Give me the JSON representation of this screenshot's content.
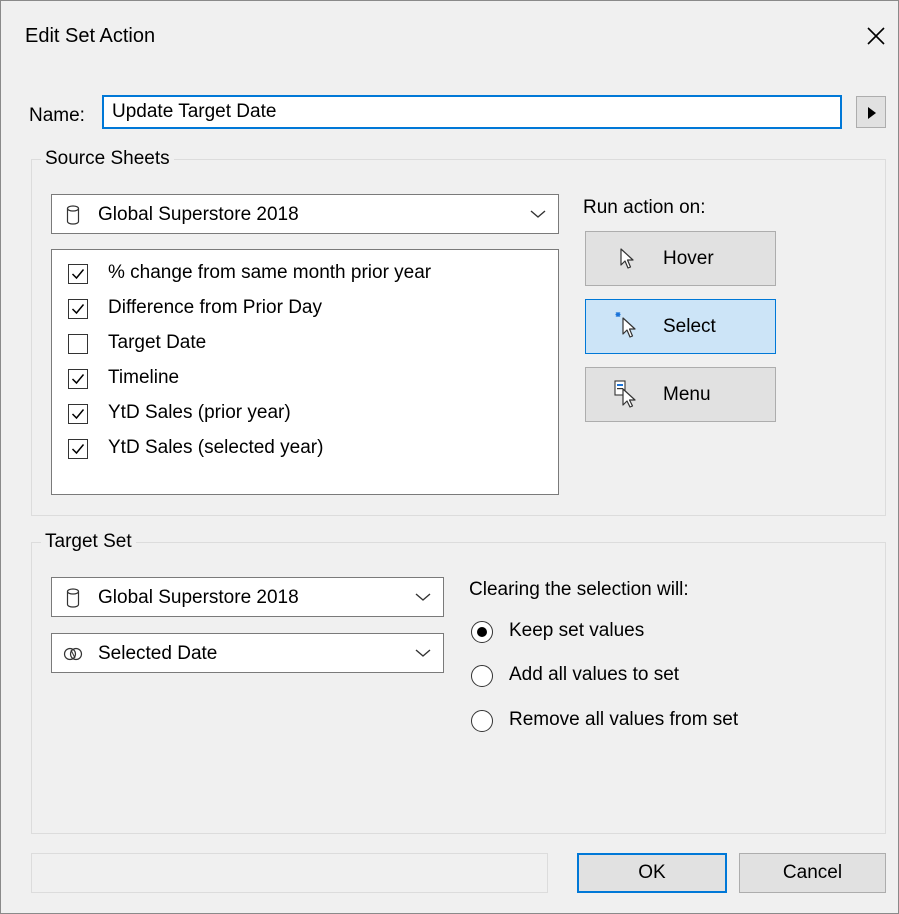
{
  "dialog": {
    "title": "Edit Set Action"
  },
  "name": {
    "label": "Name:",
    "value": "Update Target Date"
  },
  "source_sheets": {
    "legend": "Source Sheets",
    "data_source": "Global Superstore 2018",
    "sheets": [
      {
        "label": "% change from same month prior year",
        "checked": true
      },
      {
        "label": "Difference from Prior Day",
        "checked": true
      },
      {
        "label": "Target Date",
        "checked": false
      },
      {
        "label": "Timeline",
        "checked": true
      },
      {
        "label": "YtD Sales (prior year)",
        "checked": true
      },
      {
        "label": "YtD Sales (selected year)",
        "checked": true
      }
    ],
    "run_action_label": "Run action on:",
    "run_options": [
      {
        "label": "Hover",
        "icon": "hover-pointer-icon",
        "selected": false
      },
      {
        "label": "Select",
        "icon": "select-pointer-icon",
        "selected": true
      },
      {
        "label": "Menu",
        "icon": "menu-pointer-icon",
        "selected": false
      }
    ]
  },
  "target_set": {
    "legend": "Target Set",
    "data_source": "Global Superstore 2018",
    "set": "Selected Date",
    "clearing_label": "Clearing the selection will:",
    "clearing_options": [
      {
        "label": "Keep set values",
        "selected": true
      },
      {
        "label": "Add all values to set",
        "selected": false
      },
      {
        "label": "Remove all values from set",
        "selected": false
      }
    ]
  },
  "buttons": {
    "ok": "OK",
    "cancel": "Cancel"
  },
  "colors": {
    "accent": "#0078d7",
    "selected_bg": "#cce4f7",
    "dialog_bg": "#f0f0f0"
  }
}
